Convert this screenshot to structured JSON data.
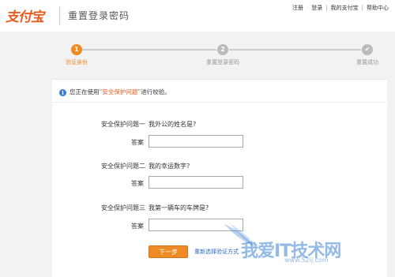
{
  "header": {
    "logo": "支付宝",
    "title": "重置登录密码",
    "links": [
      "注册",
      "登录",
      "我的支付宝",
      "帮助中心"
    ]
  },
  "steps": [
    {
      "num": "1",
      "label": "验证身份",
      "state": "active"
    },
    {
      "num": "2",
      "label": "重置登录密码",
      "state": "pending"
    },
    {
      "num": "✔",
      "label": "重置成功",
      "state": "pending"
    }
  ],
  "notice": {
    "prefix": "您正在使用",
    "highlight": "“安全保护问题”",
    "suffix": "进行校验。"
  },
  "questions": [
    {
      "label": "安全保护问题一",
      "text": "我外公的姓名是?",
      "answer_label": "答案",
      "value": ""
    },
    {
      "label": "安全保护问题二",
      "text": "我的幸运数字?",
      "answer_label": "答案",
      "value": ""
    },
    {
      "label": "安全保护问题三",
      "text": "我第一辆车的车牌是?",
      "answer_label": "答案",
      "value": ""
    }
  ],
  "actions": {
    "next": "下一步",
    "reselect": "重新选择验证方式"
  },
  "watermark": {
    "main": "我爱IT技术网",
    "sub": "www.52ij.com"
  },
  "colors": {
    "accent": "#f08a24",
    "brand": "#e65c1e",
    "link": "#2a6bc8"
  }
}
